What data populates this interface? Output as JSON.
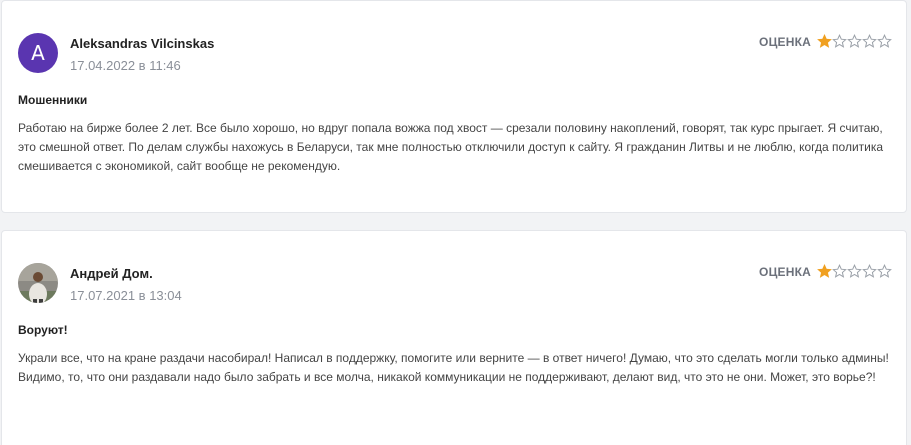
{
  "rating_label": "ОЦЕНКА",
  "star_colors": {
    "filled": "#f0a020",
    "empty": "#9aa0a8"
  },
  "reviews": [
    {
      "author": "Aleksandras Vilcinskas",
      "avatar_letter": "A",
      "avatar_color": "#5a35b0",
      "date": "17.04.2022 в 11:46",
      "rating": 1,
      "max_rating": 5,
      "title": "Мошенники",
      "body": "Работаю на бирже более 2 лет. Все было хорошо, но вдруг попала вожжа под хвост — срезали половину накоплений, говорят, так курс прыгает. Я считаю, это смешной ответ. По делам службы нахожусь в Беларуси, так мне полностью отключили доступ к сайту. Я гражданин Литвы и не люблю, когда политика смешивается с экономикой, сайт вообще не рекомендую."
    },
    {
      "author": "Андрей Дом.",
      "avatar_icon": "person-photo-icon",
      "date": "17.07.2021 в 13:04",
      "rating": 1,
      "max_rating": 5,
      "title": "Воруют!",
      "body": "Украли все, что на кране раздачи насобирал! Написал в поддержку, помогите или верните — в ответ ничего! Думаю, что это сделать могли только админы! Видимо, то, что они раздавали надо было забрать и все молча, никакой коммуникации не поддерживают, делают вид, что это не они. Может, это ворье?!"
    }
  ]
}
